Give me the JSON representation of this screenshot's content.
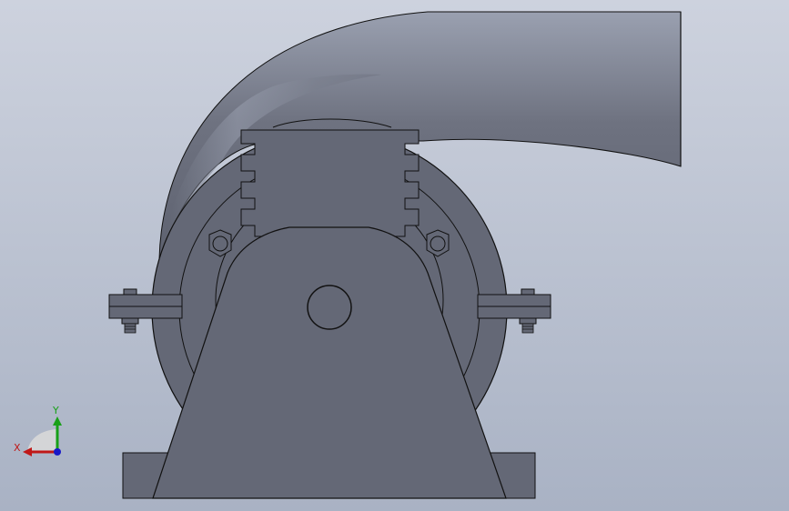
{
  "viewport": {
    "background_top": "#cdd2de",
    "background_bottom": "#a9b2c4"
  },
  "model": {
    "body_color": "#646876",
    "body_light": "#6e7280",
    "outline_color": "#111111",
    "duct_highlight": "#9aa0b0"
  },
  "triad": {
    "x_label": "X",
    "y_label": "Y",
    "x_color": "#c01818",
    "y_color": "#18a018",
    "z_color": "#1818c8"
  }
}
